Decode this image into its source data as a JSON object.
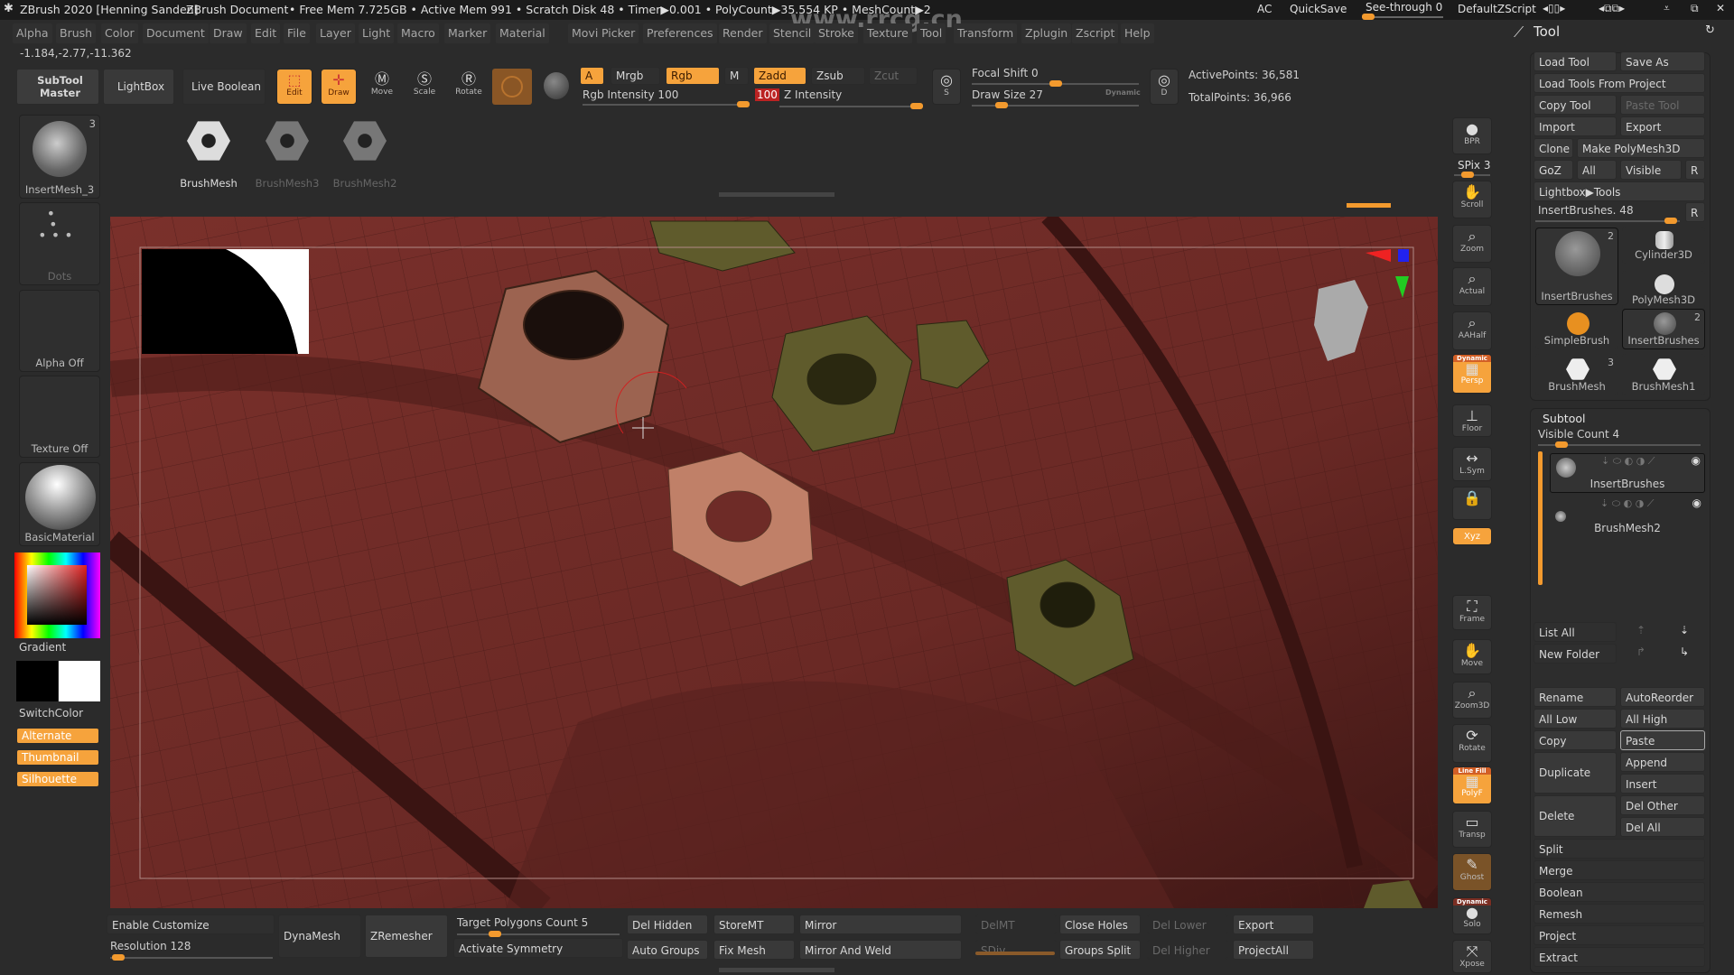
{
  "titlebar": {
    "app": "ZBrush 2020 [Henning Sanden]",
    "document": "ZBrush Document",
    "stats": "• Free Mem 7.725GB • Active Mem 991 • Scratch Disk 48 • Timer▶0.001 • PolyCount▶35.554 KP • MeshCount▶2",
    "ac": "AC",
    "quicksave": "QuickSave",
    "see_through": "See-through  0",
    "see_through_value": 0,
    "default_zscript": "DefaultZScript",
    "watermark": "www.rrcg.cn"
  },
  "menu": [
    "Alpha",
    "Brush",
    "Color",
    "Document",
    "Draw",
    "Edit",
    "File",
    "Layer",
    "Light",
    "Macro",
    "Marker",
    "Material",
    "Movie",
    "Picker",
    "Preferences",
    "Render",
    "Stencil",
    "Stroke",
    "Texture",
    "Tool",
    "Transform",
    "Zplugin",
    "Zscript",
    "Help"
  ],
  "coords": "-1.184,-2.77,-11.362",
  "shelf": {
    "subtool_master": "SubTool Master",
    "lightbox": "LightBox",
    "live_boolean": "Live Boolean",
    "edit": "Edit",
    "draw": "Draw",
    "move": "Move",
    "scale": "Scale",
    "rotate": "Rotate",
    "a": "A",
    "mrgb": "Mrgb",
    "rgb": "Rgb",
    "m": "M",
    "zadd": "Zadd",
    "zsub": "Zsub",
    "zcut": "Zcut",
    "rgb_intensity": "Rgb Intensity 100",
    "z_intensity_value": "100",
    "z_intensity": "Z Intensity",
    "focal_shift": "Focal Shift 0",
    "draw_size": "Draw Size 27",
    "dynamic": "Dynamic",
    "s": "S",
    "d": "D",
    "active_points": "ActivePoints: 36,581",
    "total_points": "TotalPoints: 36,966"
  },
  "brush_row": [
    {
      "label": "BrushMesh",
      "active": true
    },
    {
      "label": "BrushMesh3",
      "active": false
    },
    {
      "label": "BrushMesh2",
      "active": false
    }
  ],
  "left": {
    "insertmesh": "InsertMesh_3",
    "insertmesh_count": "3",
    "dots": "Dots",
    "alpha": "Alpha Off",
    "texture": "Texture Off",
    "material": "BasicMaterial",
    "gradient": "Gradient",
    "switchcolor": "SwitchColor",
    "alternate": "Alternate",
    "thumbnail": "Thumbnail",
    "silhouette": "Silhouette",
    "main_color": "#000000",
    "secondary_color": "#ffffff"
  },
  "right_shelf": {
    "bpr": "BPR",
    "spix": "SPix 3",
    "scroll": "Scroll",
    "zoom": "Zoom",
    "actual": "Actual",
    "aahalf": "AAHalf",
    "persp": "Persp",
    "persp_top": "Dynamic",
    "floor": "Floor",
    "lsym": "L.Sym",
    "xyz": "Xyz",
    "frame": "Frame",
    "move": "Move",
    "zoom3d": "Zoom3D",
    "rotate": "Rotate",
    "polyf": "PolyF",
    "polyf_top": "Line Fill",
    "transp": "Transp",
    "ghost": "Ghost",
    "solo": "Solo",
    "solo_top": "Dynamic",
    "xpose": "Xpose"
  },
  "tool": {
    "title": "Tool",
    "load_tool": "Load Tool",
    "save_as": "Save As",
    "load_from_project": "Load Tools From Project",
    "copy_tool": "Copy Tool",
    "paste_tool": "Paste Tool",
    "import": "Import",
    "export": "Export",
    "clone": "Clone",
    "make_polymesh": "Make PolyMesh3D",
    "goz": "GoZ",
    "all": "All",
    "visible": "Visible",
    "r": "R",
    "lightbox_tools": "Lightbox▶Tools",
    "insertbrushes_slider": "InsertBrushes. 48",
    "thumbs": [
      {
        "label": "InsertBrushes",
        "count": "2"
      },
      {
        "label": "Cylinder3D"
      },
      {
        "label": "PolyMesh3D"
      },
      {
        "label": "SimpleBrush"
      },
      {
        "label": "InsertBrushes",
        "count": "2"
      },
      {
        "label": "BrushMesh",
        "count": "3"
      },
      {
        "label": "BrushMesh1"
      }
    ]
  },
  "subtool": {
    "title": "Subtool",
    "visible_count": "Visible Count 4",
    "items": [
      {
        "name": "InsertBrushes",
        "selected": true
      },
      {
        "name": "BrushMesh2",
        "selected": false
      }
    ],
    "list_all": "List All",
    "new_folder": "New Folder",
    "rename": "Rename",
    "autoreorder": "AutoReorder",
    "all_low": "All Low",
    "all_high": "All High",
    "copy": "Copy",
    "paste": "Paste",
    "duplicate": "Duplicate",
    "append": "Append",
    "insert": "Insert",
    "delete": "Delete",
    "del_other": "Del Other",
    "del_all": "Del All",
    "split": "Split",
    "merge": "Merge",
    "boolean": "Boolean",
    "remesh": "Remesh",
    "project": "Project",
    "extract": "Extract"
  },
  "bottom": {
    "enable_customize": "Enable Customize",
    "resolution": "Resolution 128",
    "dynamesh": "DynaMesh",
    "zremesher": "ZRemesher",
    "target_polygons": "Target Polygons Count 5",
    "activate_symmetry": "Activate Symmetry",
    "del_hidden": "Del Hidden",
    "auto_groups": "Auto Groups",
    "storemt": "StoreMT",
    "fix_mesh": "Fix Mesh",
    "mirror": "Mirror",
    "mirror_weld": "Mirror And Weld",
    "delmt": "DelMT",
    "sdiv": "SDiv",
    "close_holes": "Close Holes",
    "groups_split": "Groups Split",
    "del_lower": "Del Lower",
    "del_higher": "Del Higher",
    "export": "Export",
    "projectall": "ProjectAll"
  },
  "colors": {
    "accent": "#f6a33c",
    "mesh": "#6e2b27",
    "olive": "#5f5b2c",
    "tan": "#b0735e"
  }
}
